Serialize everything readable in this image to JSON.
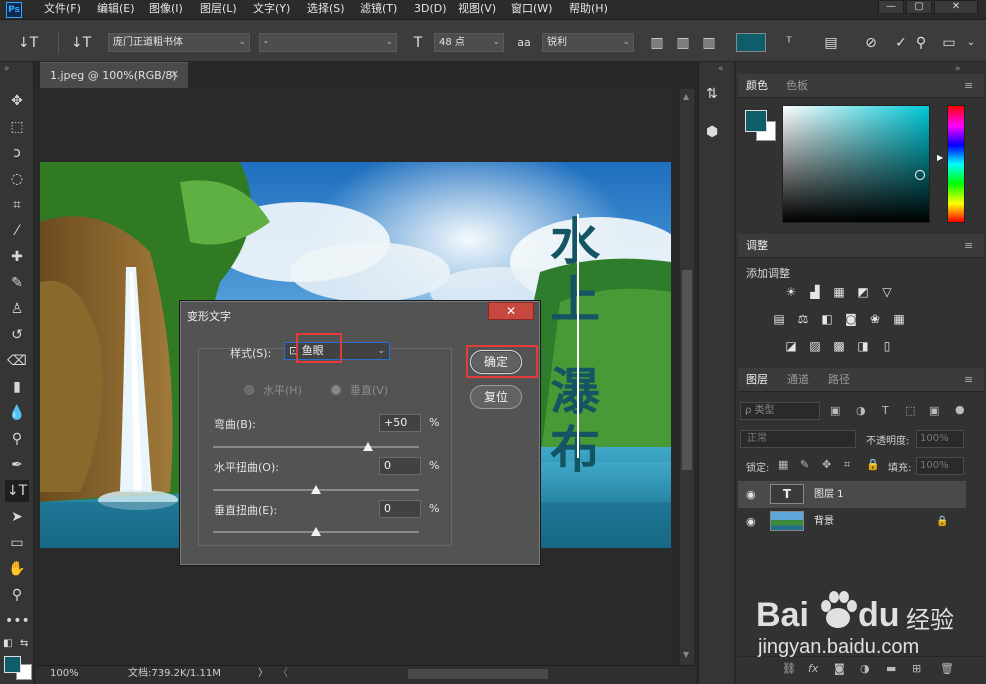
{
  "app": {
    "logo": "Ps"
  },
  "menu": [
    "文件(F)",
    "编辑(E)",
    "图像(I)",
    "图层(L)",
    "文字(Y)",
    "选择(S)",
    "滤镜(T)",
    "3D(D)",
    "视图(V)",
    "窗口(W)",
    "帮助(H)"
  ],
  "window_controls": {
    "minimize": "—",
    "restore": "▢",
    "close": "✕"
  },
  "options": {
    "tool_glyph": "↓T",
    "orient_glyph": "↓T",
    "font_family": "庞门正道粗书体",
    "font_style": "-",
    "size_glyph": "T",
    "font_size": "48 点",
    "aa_glyph": "aa",
    "antialias": "锐利",
    "text_color": "#0d5d6a"
  },
  "document": {
    "tab_title": "1.jpeg @ 100%(RGB/8)",
    "tab_close": "✕",
    "vertical_text": [
      "水",
      "上",
      "瀑",
      "布"
    ],
    "text_color": "#145563"
  },
  "status": {
    "zoom": "100%",
    "doc_size": "文档:739.2K/1.11M",
    "arrow": "〉"
  },
  "dialog": {
    "title": "变形文字",
    "close": "✕",
    "style_label": "样式(S):",
    "style_value": "鱼眼",
    "style_icon": "⊡",
    "horizontal_label": "水平(H)",
    "vertical_label": "垂直(V)",
    "bend_label": "弯曲(B):",
    "bend_value": "+50",
    "bend": 0.75,
    "hdist_label": "水平扭曲(O):",
    "hdist_value": "0",
    "hdist": 0.5,
    "vdist_label": "垂直扭曲(E):",
    "vdist_value": "0",
    "vdist": 0.5,
    "percent": "%",
    "ok": "确定",
    "reset": "复位"
  },
  "panels": {
    "color_tabs": [
      "颜色",
      "色板"
    ],
    "menu_glyph": "≡",
    "adjust_title": "调整",
    "adjust_add": "添加调整",
    "layers_tabs": [
      "图层",
      "通道",
      "路径"
    ],
    "kind_filter": "ρ 类型",
    "blend_mode": "正常",
    "opacity_label": "不透明度:",
    "opacity_value": "100%",
    "lock_label": "锁定:",
    "fill_label": "填充:",
    "fill_value": "100%",
    "layers": [
      {
        "name": "图层 1",
        "thumb": "T"
      },
      {
        "name": "背景",
        "lock": "🔒"
      }
    ],
    "eye": "◉",
    "foreground": "#0d5d6a",
    "background": "#ffffff"
  },
  "watermark": {
    "brand": "Bai",
    "brand2": "du",
    "brand_cn": "经验",
    "url": "jingyan.baidu.com"
  }
}
